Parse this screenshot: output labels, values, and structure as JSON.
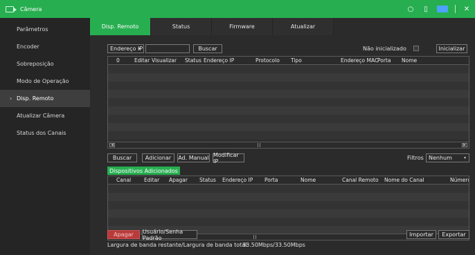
{
  "titlebar": {
    "title": "Câmera"
  },
  "sidebar": {
    "items": [
      {
        "label": "Parâmetros",
        "active": false
      },
      {
        "label": "Encoder",
        "active": false
      },
      {
        "label": "Sobreposição",
        "active": false
      },
      {
        "label": "Modo de Operação",
        "active": false
      },
      {
        "label": "Disp. Remoto",
        "active": true
      },
      {
        "label": "Atualizar Câmera",
        "active": false
      },
      {
        "label": "Status dos Canais",
        "active": false
      }
    ],
    "active_chevron": "›"
  },
  "tabs": [
    "Disp. Remoto",
    "Status",
    "Firmware",
    "Atualizar"
  ],
  "search": {
    "type_select": "Endereço IP",
    "search_label": "Buscar",
    "uninit_label": "Não inicializado",
    "init_label": "Inicializar"
  },
  "device_table": {
    "columns": [
      "0",
      "Editar",
      "Visualizar",
      "Status",
      "Endereço IP",
      "Protocolo",
      "Tipo",
      "Endereço MAC",
      "Porta",
      "Nome"
    ]
  },
  "actions": {
    "buscar": "Buscar",
    "adicionar": "Adicionar",
    "ad_manual": "Ad. Manual",
    "modificar_ip": "Modificar IP",
    "filtros_label": "Filtros",
    "filtros_value": "Nenhum"
  },
  "added": {
    "title": "Dispositivos Adicionados",
    "columns": [
      "Canal",
      "Editar",
      "Apagar",
      "Status",
      "Endereço IP",
      "Porta",
      "Nome",
      "Canal Remoto",
      "Nome do Canal",
      "Número"
    ]
  },
  "footer": {
    "apagar": "Apagar",
    "default_user": "Usuário/Senha Padrão",
    "importar": "Importar",
    "exportar": "Exportar",
    "bandwidth_label": "Largura de banda restante/Largura de banda total:",
    "bandwidth_value": "33.50Mbps/33.50Mbps"
  }
}
